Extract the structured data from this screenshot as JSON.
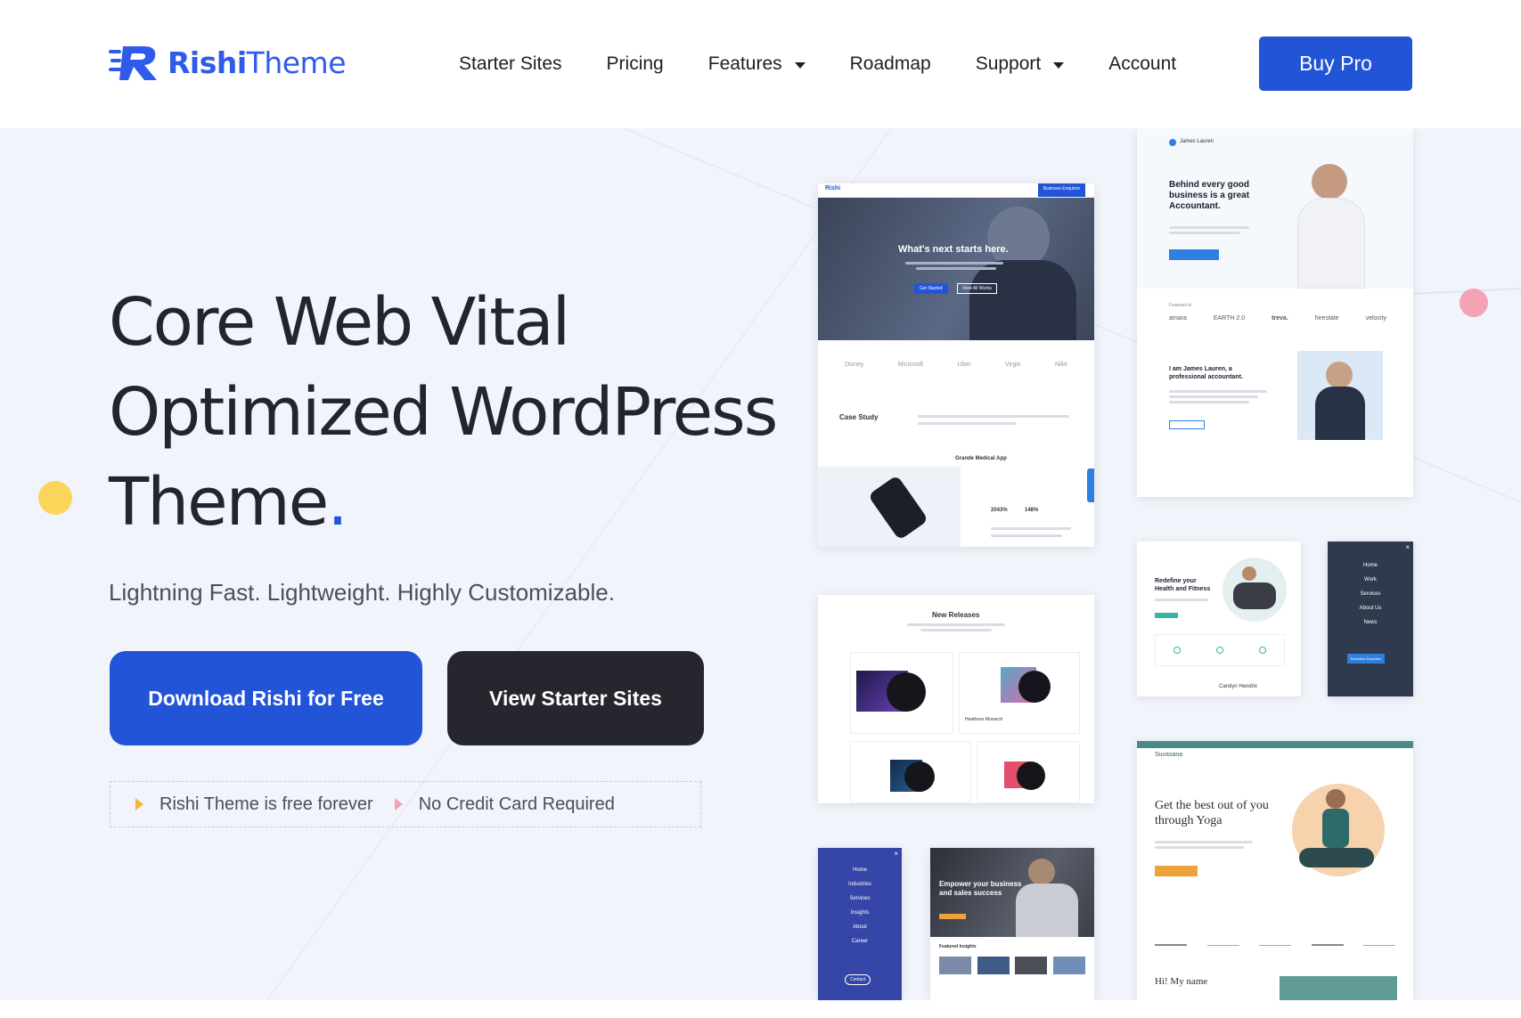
{
  "brand": {
    "name_bold": "Rishi",
    "name_light": "Theme",
    "primary_color": "#2254d8",
    "dark_color": "#26272e",
    "accent_yellow": "#fbd45a",
    "accent_pink": "#f3a3b4"
  },
  "nav": {
    "items": [
      {
        "label": "Starter Sites",
        "has_caret": false
      },
      {
        "label": "Pricing",
        "has_caret": false
      },
      {
        "label": "Features",
        "has_caret": true
      },
      {
        "label": "Roadmap",
        "has_caret": false
      },
      {
        "label": "Support",
        "has_caret": true
      },
      {
        "label": "Account",
        "has_caret": false
      }
    ],
    "cta": "Buy Pro"
  },
  "hero": {
    "headline_line1": "Core Web Vital",
    "headline_line2": "Optimized WordPress",
    "headline_line3": "Theme",
    "headline_period": ".",
    "subline": "Lightning Fast. Lightweight. Highly Customizable.",
    "primary_button": "Download Rishi for Free",
    "secondary_button": "View Starter Sites",
    "feature_1": "Rishi Theme is free forever",
    "feature_2": "No Credit Card Required"
  },
  "mockups": {
    "agency": {
      "brand": "Rishi",
      "cta": "Business Enquires",
      "hero_title": "What's next starts here.",
      "btn_1": "Get Started",
      "btn_2": "View All Works",
      "partners": [
        "Disney",
        "Microsoft",
        "Uber",
        "Virgin",
        "Nike"
      ],
      "case_study": "Case Study",
      "project": "Grande Medical App",
      "stat_1": "2043%",
      "stat_2": "148%"
    },
    "accountant": {
      "brand": "James Lauren",
      "title": "Behind every good business is a great Accountant.",
      "featured": "Featured in",
      "logos": [
        "amara",
        "EARTH 2.0",
        "treva.",
        "hirestate",
        "velocity"
      ],
      "about": "I am James Lauren, a professional accountant."
    },
    "music": {
      "title": "New Releases",
      "album": "Heathens Monarch"
    },
    "fitness": {
      "title": "Redefine your Health and Fitness",
      "trainer": "Carolyn Hendrix"
    },
    "menu_dark": {
      "items": [
        "Home",
        "Work",
        "Services",
        "About Us",
        "News"
      ],
      "cta": "Business Enquiries"
    },
    "yoga": {
      "brand": "Suvasana",
      "title": "Get the best out of you through Yoga",
      "greeting": "Hi! My name"
    },
    "menu_blue": {
      "items": [
        "Home",
        "Industries",
        "Services",
        "Insights",
        "About",
        "Career"
      ],
      "cta": "Contact"
    },
    "business": {
      "title": "Empower your business and sales success",
      "section": "Featured Insights"
    }
  }
}
